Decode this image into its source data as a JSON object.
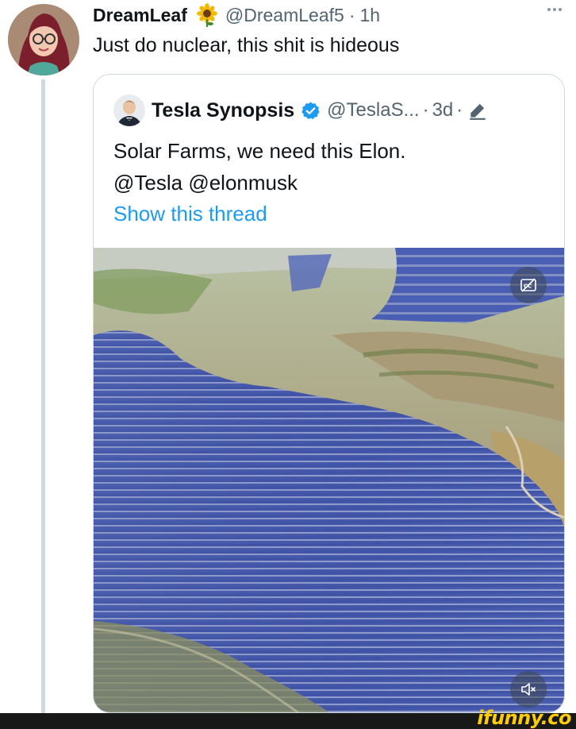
{
  "tweet": {
    "display_name": "DreamLeaf",
    "name_emoji_icon": "sunflower-icon",
    "handle": "@DreamLeaf5",
    "separator": "·",
    "time": "1h",
    "text": "Just do nuclear, this shit is hideous",
    "more_icon": "more-horizontal-icon"
  },
  "quote": {
    "display_name": "Tesla Synopsis",
    "verified_icon": "verified-badge-icon",
    "handle": "@TeslaS...",
    "separator": "·",
    "time": "3d",
    "separator2": "·",
    "edit_icon": "edited-pencil-icon",
    "text_line1": "Solar Farms, we need this Elon.",
    "text_line2": "@Tesla @elonmusk",
    "show_thread": "Show this thread",
    "media": {
      "captions_icon": "closed-captions-off-icon",
      "mute_icon": "volume-muted-icon"
    }
  },
  "watermark": "ifunny.co",
  "colors": {
    "link": "#1d9bf0",
    "secondary_text": "#536471",
    "border": "#cfd9de",
    "verified": "#1d9bf0",
    "watermark": "#ffcc00"
  }
}
